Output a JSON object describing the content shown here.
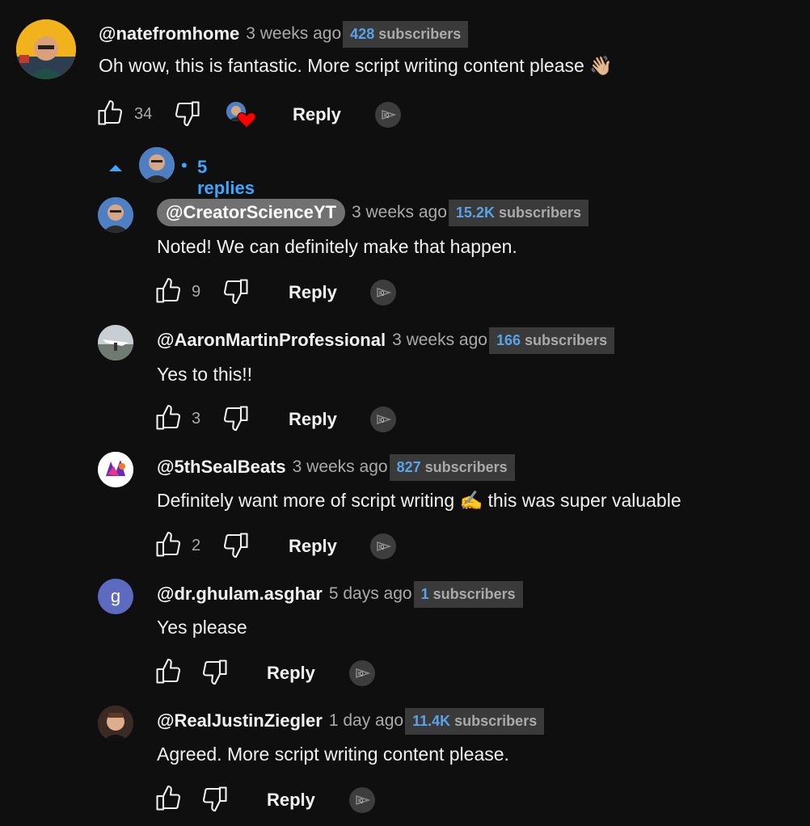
{
  "comment": {
    "author": "@natefromhome",
    "time": "3 weeks ago",
    "subs_num": "428",
    "subs_word": "subscribers",
    "text": "Oh wow, this is fantastic. More script writing content please 👋🏼",
    "likes": "34",
    "reply_label": "Reply"
  },
  "replies_toggle": {
    "label": "5 replies",
    "dot": "•"
  },
  "replies": [
    {
      "author": "@CreatorScienceYT",
      "time": "3 weeks ago",
      "subs_num": "15.2K",
      "subs_word": "subscribers",
      "text": "Noted! We can definitely make that happen.",
      "likes": "9",
      "reply_label": "Reply"
    },
    {
      "author": "@AaronMartinProfessional",
      "time": "3 weeks ago",
      "subs_num": "166",
      "subs_word": "subscribers",
      "text": "Yes to this!!",
      "likes": "3",
      "reply_label": "Reply"
    },
    {
      "author": "@5thSealBeats",
      "time": "3 weeks ago",
      "subs_num": "827",
      "subs_word": "subscribers",
      "text": "Definitely want more of script writing ✍️ this was super valuable",
      "likes": "2",
      "reply_label": "Reply"
    },
    {
      "author": "@dr.ghulam.asghar",
      "avatar_letter": "g",
      "time": "5 days ago",
      "subs_num": "1",
      "subs_word": "subscribers",
      "text": "Yes please",
      "likes": "",
      "reply_label": "Reply"
    },
    {
      "author": "@RealJustinZiegler",
      "time": "1 day ago",
      "subs_num": "11.4K",
      "subs_word": "subscribers",
      "text": "Agreed. More script writing content please.",
      "likes": "",
      "reply_label": "Reply"
    }
  ],
  "colors": {
    "background": "#0f0f0f",
    "link_blue": "#3ea6ff",
    "heart": "#ff0000"
  },
  "icons": [
    "thumb-up-icon",
    "thumb-down-icon",
    "heart-icon",
    "caret-up-icon",
    "ia-badge-icon"
  ]
}
